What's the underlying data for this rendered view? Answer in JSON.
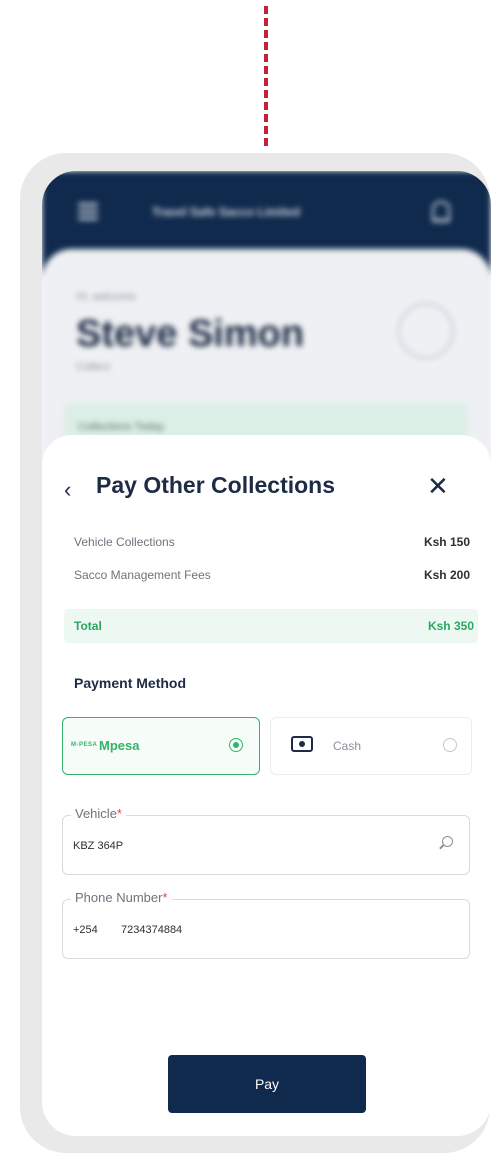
{
  "background_app": {
    "header_title": "Travel Safe Sacco Limited",
    "welcome_text": "Hi, welcome",
    "user_name": "Steve Simon",
    "user_role": "Collect",
    "collections_today_label": "Collections Today"
  },
  "sheet": {
    "title": "Pay Other Collections",
    "line_items": [
      {
        "label": "Vehicle Collections",
        "amount": "Ksh 150"
      },
      {
        "label": "Sacco Management Fees",
        "amount": "Ksh 200"
      }
    ],
    "total": {
      "label": "Total",
      "amount": "Ksh 350"
    },
    "payment_method_heading": "Payment Method",
    "payment_options": [
      {
        "logo_text": "M-PESA",
        "label": "Mpesa",
        "selected": true
      },
      {
        "label": "Cash",
        "selected": false
      }
    ],
    "vehicle_field": {
      "label": "Vehicle",
      "required_mark": "*",
      "value": "KBZ 364P"
    },
    "phone_field": {
      "label": "Phone Number",
      "required_mark": "*",
      "country_code": "+254",
      "value": "7234374884"
    },
    "pay_button_label": "Pay"
  },
  "colors": {
    "primary": "#0f2a4d",
    "accent_green": "#34b36a",
    "required_red": "#e0474f",
    "connector": "#c4213a"
  },
  "icons": [
    "menu-icon",
    "bell-icon",
    "avatar-icon",
    "back-icon",
    "close-icon",
    "cash-icon",
    "search-icon"
  ]
}
